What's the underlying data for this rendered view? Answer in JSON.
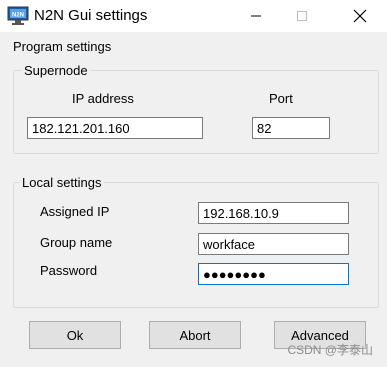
{
  "window": {
    "title": "N2N Gui settings",
    "icon": "monitor-icon",
    "controls": [
      "minimize-icon",
      "maximize-icon",
      "close-icon"
    ]
  },
  "program_settings_label": "Program settings",
  "supernode": {
    "group_label": "Supernode",
    "ip_label": "IP address",
    "ip_value": "182.121.201.160",
    "port_label": "Port",
    "port_value": "82"
  },
  "local_settings": {
    "group_label": "Local settings",
    "assigned_ip_label": "Assigned IP",
    "assigned_ip_value": "192.168.10.9",
    "group_name_label": "Group name",
    "group_name_value": "workface",
    "password_label": "Password",
    "password_value": "●●●●●●●●"
  },
  "buttons": {
    "ok": "Ok",
    "abort": "Abort",
    "advanced": "Advanced"
  },
  "watermark": "CSDN @李泰山",
  "colors": {
    "focus_border": "#0078d7",
    "button_bg": "#e1e1e1",
    "dialog_bg": "#f0f0f0"
  }
}
